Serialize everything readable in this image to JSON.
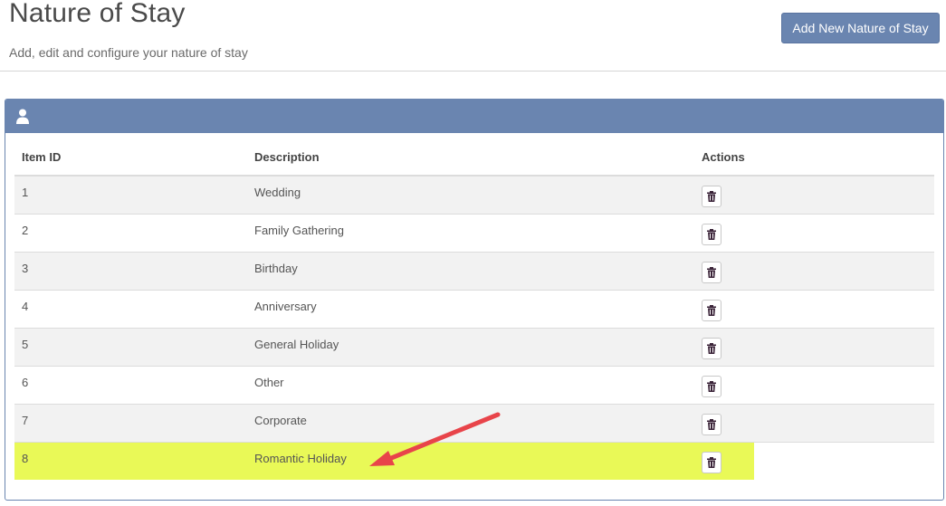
{
  "header": {
    "title": "Nature of Stay",
    "subtitle": "Add, edit and configure your nature of stay",
    "add_button_label": "Add New Nature of Stay"
  },
  "panel": {
    "heading_icon": "user-icon"
  },
  "table": {
    "columns": [
      "Item ID",
      "Description",
      "Actions"
    ],
    "rows": [
      {
        "id": "1",
        "description": "Wedding"
      },
      {
        "id": "2",
        "description": "Family Gathering"
      },
      {
        "id": "3",
        "description": "Birthday"
      },
      {
        "id": "4",
        "description": "Anniversary"
      },
      {
        "id": "5",
        "description": "General Holiday"
      },
      {
        "id": "6",
        "description": "Other"
      },
      {
        "id": "7",
        "description": "Corporate"
      },
      {
        "id": "8",
        "description": "Romantic Holiday"
      }
    ],
    "action_icon": "trash-icon"
  },
  "colors": {
    "accent": "#6a85b0",
    "highlight": "#e9f957",
    "annotation_arrow": "#e8444a"
  }
}
